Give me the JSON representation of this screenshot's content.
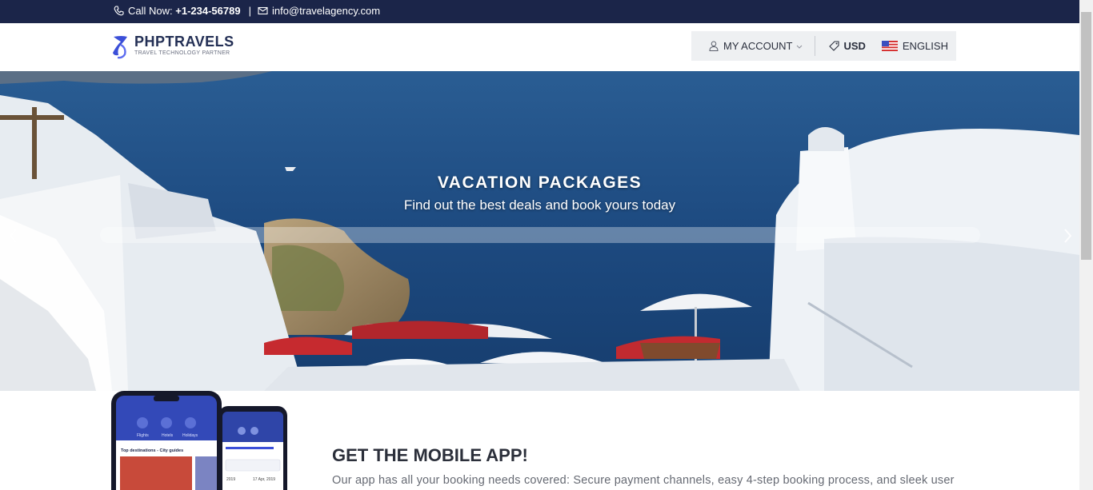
{
  "topbar": {
    "call_label": "Call Now:",
    "phone": "+1-234-56789",
    "separator": "|",
    "email": "info@travelagency.com",
    "phone_icon": "phone-icon",
    "email_icon": "envelope-icon"
  },
  "header": {
    "logo_name": "PHPTRAVELS",
    "logo_tagline": "TRAVEL TECHNOLOGY PARTNER",
    "account_label": "MY ACCOUNT",
    "currency_label": "USD",
    "language_label": "ENGLISH",
    "icons": [
      "user-icon",
      "chevron-down-icon",
      "tag-icon",
      "us-flag-icon"
    ]
  },
  "hero": {
    "title": "VACATION PACKAGES",
    "subtitle": "Find out the best deals and book yours today",
    "icons": [
      "chevron-left-icon",
      "chevron-right-icon"
    ]
  },
  "app_section": {
    "title": "GET THE MOBILE APP!",
    "description": "Our app has all your booking needs covered: Secure payment channels, easy 4-step booking process, and sleek user",
    "phone_screen": {
      "tabs": [
        "Flights",
        "Hotels",
        "Holidays"
      ],
      "list_heading": "Top destinations - City guides",
      "date_left": "2019",
      "date_right": "17 Apr, 2019"
    }
  },
  "colors": {
    "topbar_bg": "#1b2549",
    "brand_blue": "#3b4fd8",
    "header_right_bg": "#eef0f2",
    "sea": "#1f4f86"
  }
}
